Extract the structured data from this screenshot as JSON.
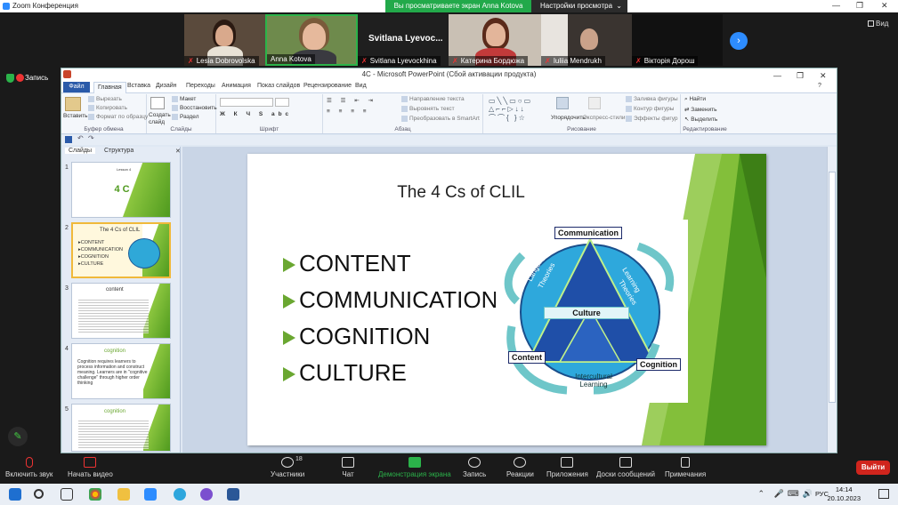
{
  "zoom": {
    "window_title": "Zoom Конференция",
    "share_banner": "Вы просматриваете экран Anna Kotova",
    "view_options": "Настройки просмотра",
    "view_label": "Вид",
    "record_label": "Запись"
  },
  "participants": [
    {
      "name": "Lesia Dobrovolska",
      "muted": true
    },
    {
      "name": "Anna Kotova",
      "muted": false
    },
    {
      "name": "Svitlana Lyevockhina",
      "muted": true,
      "header": "Svitlana Lyevoc..."
    },
    {
      "name": "Катерина Бордюжа",
      "muted": true
    },
    {
      "name": "Iuliia Mendrukh",
      "muted": true
    },
    {
      "name": "Вікторія Дорош",
      "muted": true
    }
  ],
  "ppt": {
    "title": "4С - Microsoft PowerPoint (Сбой активации продукта)",
    "tabs": [
      "Файл",
      "Главная",
      "Вставка",
      "Дизайн",
      "Переходы",
      "Анимация",
      "Показ слайдов",
      "Рецензирование",
      "Вид"
    ],
    "groups": [
      "Буфер обмена",
      "Слайды",
      "Шрифт",
      "Абзац",
      "Рисование",
      "Редактирование"
    ],
    "ribbon": {
      "paste": "Вставить",
      "cut": "Вырезать",
      "copy": "Копировать",
      "format": "Формат по образцу",
      "new_slide": "Создать слайд",
      "layout": "Макет",
      "reset": "Восстановить",
      "section": "Раздел",
      "text_dir": "Направление текста",
      "align_text": "Выровнять текст",
      "smartart": "Преобразовать в SmartArt",
      "arrange": "Упорядочить",
      "quick_styles": "Экспресс-стили",
      "fill": "Заливка фигуры",
      "outline": "Контур фигуры",
      "effects": "Эффекты фигур",
      "find": "Найти",
      "replace": "Заменить",
      "select": "Выделить"
    },
    "panel_tabs": [
      "Слайды",
      "Структура"
    ],
    "thumbs": [
      {
        "num": "1",
        "title": "4 C",
        "small": "Lesson 4"
      },
      {
        "num": "2",
        "title": "The 4 Cs of CLIL",
        "items": [
          "CONTENT",
          "COMMUNICATION",
          "COGNITION",
          "CULTURE"
        ]
      },
      {
        "num": "3",
        "title": "content"
      },
      {
        "num": "4",
        "title": "cognition",
        "text": "Cognition requires learners to process information and construct meaning. Learners are in \"cognitive challenge\" through higher order thinking"
      },
      {
        "num": "5",
        "title": "cognition"
      }
    ]
  },
  "slide": {
    "title": "The 4 Cs of CLIL",
    "bullets": [
      "CONTENT",
      "COMMUNICATION",
      "COGNITION",
      "CULTURE"
    ],
    "diagram": {
      "communication": "Communication",
      "culture": "Culture",
      "content": "Content",
      "cognition": "Cognition",
      "language_learning": "Language Learning Theories",
      "learning_theories": "Learning Theories",
      "intercultural": "Intercultural Learning"
    },
    "accent": "#6aa731"
  },
  "toolbar": {
    "audio": "Включить звук",
    "video": "Начать видео",
    "participants": "Участники",
    "participants_count": "18",
    "chat": "Чат",
    "share": "Демонстрация экрана",
    "record": "Запись",
    "reactions": "Реакции",
    "apps": "Приложения",
    "whiteboards": "Доски сообщений",
    "notes": "Примечания",
    "end": "Выйти"
  },
  "taskbar": {
    "lang": "РУС",
    "time": "14:14",
    "date": "20.10.2023"
  }
}
